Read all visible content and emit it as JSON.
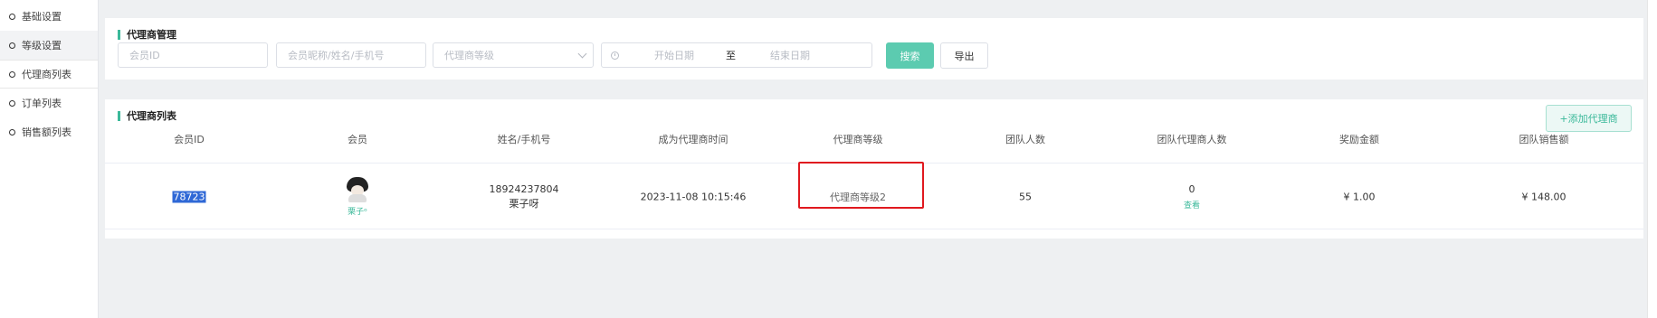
{
  "sidebar": {
    "items": [
      {
        "label": "基础设置"
      },
      {
        "label": "等级设置"
      },
      {
        "label": "代理商列表"
      },
      {
        "label": "订单列表"
      },
      {
        "label": "销售额列表"
      }
    ]
  },
  "filter": {
    "title": "代理商管理",
    "member_id_placeholder": "会员ID",
    "name_placeholder": "会员昵称/姓名/手机号",
    "level_placeholder": "代理商等级",
    "date_start": "开始日期",
    "date_to": "至",
    "date_end": "结束日期",
    "search_label": "搜索",
    "export_label": "导出"
  },
  "list": {
    "title": "代理商列表",
    "add_label": "+添加代理商",
    "columns": [
      "会员ID",
      "会员",
      "姓名/手机号",
      "成为代理商时间",
      "代理商等级",
      "团队人数",
      "团队代理商人数",
      "奖励金额",
      "团队销售额"
    ],
    "rows": [
      {
        "member_id": "78723",
        "nickname": "栗子ᵒ",
        "phone": "18924237804",
        "name": "栗子呀",
        "joined": "2023-11-08 10:15:46",
        "level": "代理商等级2",
        "team_count": "55",
        "team_agent_count": "0",
        "view_label": "查看",
        "reward": "¥ 1.00",
        "team_sales": "¥ 148.00"
      }
    ]
  },
  "colors": {
    "accent": "#5ccbb0",
    "highlight_box": "#e0191f",
    "selection": "#2f68d6"
  }
}
